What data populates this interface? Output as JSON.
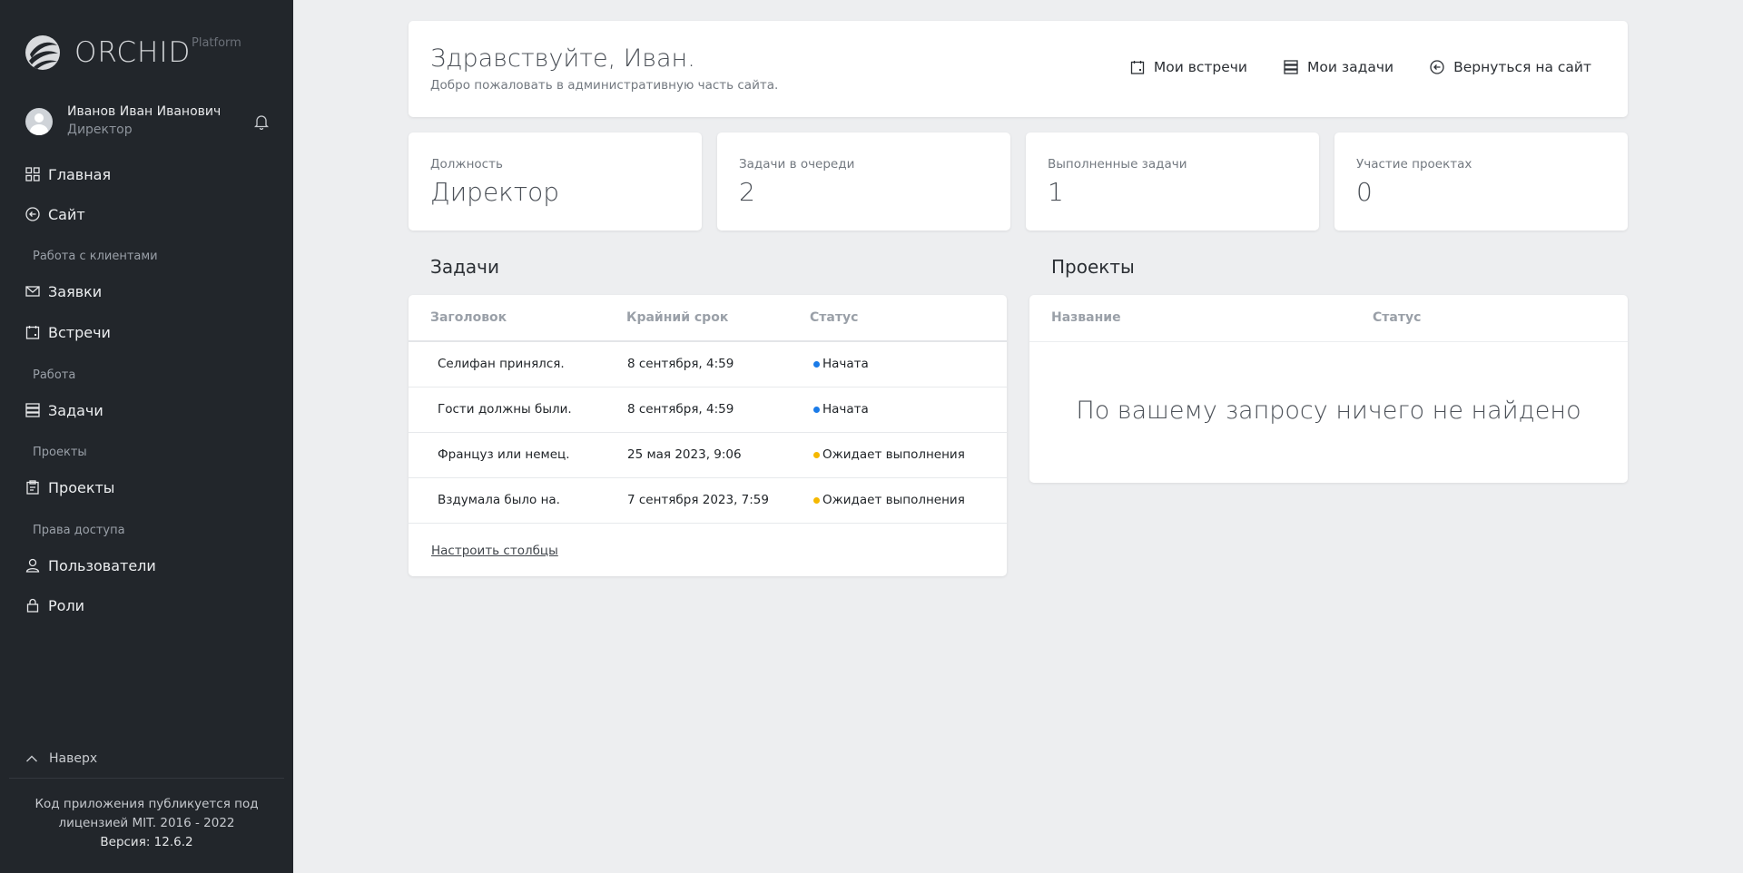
{
  "sidebar": {
    "brand_name": "ORCHID",
    "brand_sub": "Platform",
    "user_name": "Иванов Иван Иванович",
    "user_role": "Директор",
    "nav": {
      "home": "Главная",
      "site": "Сайт",
      "section_clients": "Работа с клиентами",
      "requests": "Заявки",
      "meetings": "Встречи",
      "section_work": "Работа",
      "tasks": "Задачи",
      "section_projects": "Проекты",
      "projects": "Проекты",
      "section_access": "Права доступа",
      "users": "Пользователи",
      "roles": "Роли"
    },
    "to_top": "Наверх",
    "footer_line1": "Код приложения публикуется под",
    "footer_line2": "лицензией MIT. 2016 - 2022",
    "footer_version": "Версия: 12.6.2"
  },
  "header": {
    "title": "Здравствуйте, Иван.",
    "subtitle": "Добро пожаловать в административную часть сайта.",
    "links": {
      "meetings": "Мои встречи",
      "tasks": "Мои задачи",
      "back": "Вернуться на сайт"
    }
  },
  "stats": [
    {
      "label": "Должность",
      "value": "Директор"
    },
    {
      "label": "Задачи в очереди",
      "value": "2"
    },
    {
      "label": "Выполненные задачи",
      "value": "1"
    },
    {
      "label": "Участие проектах",
      "value": "0"
    }
  ],
  "tasks": {
    "title": "Задачи",
    "columns": [
      "Заголовок",
      "Крайний срок",
      "Статус"
    ],
    "rows": [
      {
        "title": "Селифан принялся.",
        "deadline": "8 сентября, 4:59",
        "status": "Начата"
      },
      {
        "title": "Гости должны были.",
        "deadline": "8 сентября, 4:59",
        "status": "Начата"
      },
      {
        "title": "Француз или немец.",
        "deadline": "25 мая 2023, 9:06",
        "status": "Ожидает выполнения"
      },
      {
        "title": "Вздумала было на.",
        "deadline": "7 сентября 2023, 7:59",
        "status": "Ожидает выполнения"
      }
    ],
    "configure": "Настроить столбцы"
  },
  "projects": {
    "title": "Проекты",
    "columns": [
      "Название",
      "Статус"
    ],
    "empty": "По вашему запросу ничего не найдено"
  },
  "colors": {
    "sidebar_bg": "#22262b",
    "page_bg": "#edeef0",
    "status_started": "#1a7be8",
    "status_waiting": "#f5b800"
  }
}
